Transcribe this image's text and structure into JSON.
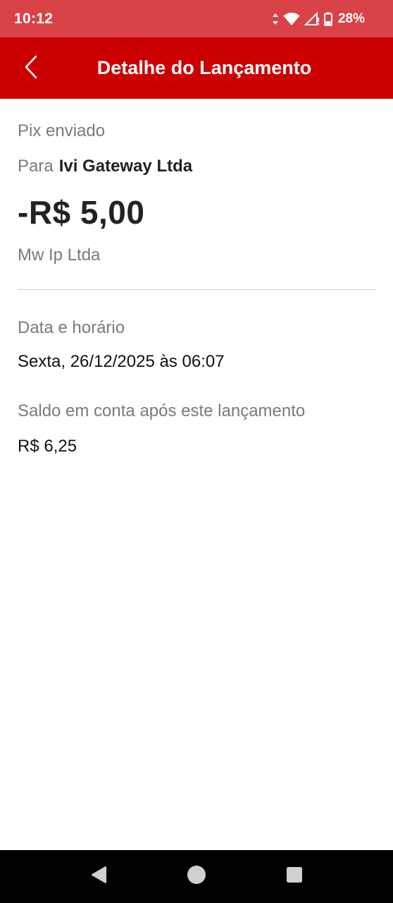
{
  "status_bar": {
    "time": "10:12",
    "battery": "28%",
    "icons": [
      "data-arrows-icon",
      "wifi-icon",
      "signal-icon",
      "battery-icon"
    ],
    "background": "#d94347"
  },
  "app_bar": {
    "title": "Detalhe do Lançamento",
    "back_icon": "chevron-left-icon",
    "background": "#cc0000"
  },
  "transaction": {
    "type": "Pix enviado",
    "recipient_label": "Para",
    "recipient_name": "Ivi Gateway Ltda",
    "amount": "-R$ 5,00",
    "institution": "Mw Ip Ltda"
  },
  "details": {
    "date_label": "Data e horário",
    "date_value": "Sexta, 26/12/2025 às 06:07",
    "balance_label": "Saldo em conta após este lançamento",
    "balance_value": "R$ 6,25"
  },
  "nav_bar": {
    "icons": [
      "nav-back-icon",
      "nav-home-icon",
      "nav-recents-icon"
    ]
  }
}
